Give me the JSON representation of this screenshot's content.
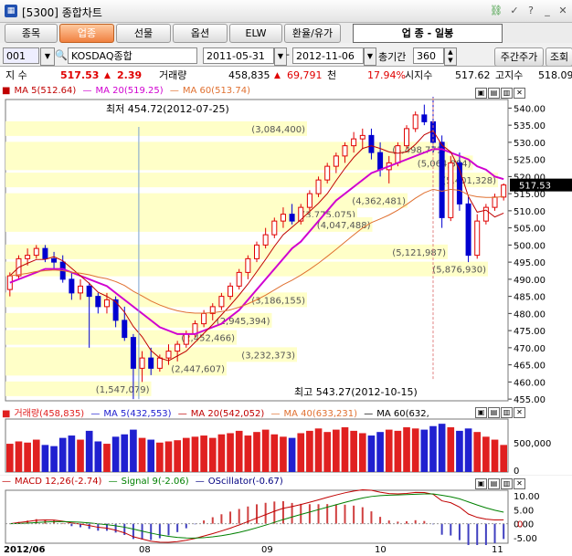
{
  "window": {
    "title": "[5300] 종합차트"
  },
  "nav": {
    "buttons": [
      "종목",
      "업종",
      "선물",
      "옵션",
      "ELW",
      "환율/유가"
    ],
    "selected": 1,
    "header_label": "업  종 - 일봉"
  },
  "datebar": {
    "code": "001",
    "index_name": "KOSDAQ종합",
    "start_date": "2011-05-31",
    "end_date": "2012-11-06",
    "period_label": "총기간",
    "period_value": "360",
    "weekly_btn": "주간주가",
    "query_btn": "조회"
  },
  "quote": {
    "label_index": "지 수",
    "index_value": "517.53",
    "change": "2.39",
    "label_volume": "거래량",
    "volume": "458,835",
    "volume_change": "69,791",
    "unit": "천",
    "volume_ratio": "17.94%",
    "label_open": "시지수",
    "open_value": "517.62",
    "label_high": "고지수",
    "high_value": "518.09"
  },
  "colors": {
    "up": "#e00000",
    "down": "#0000d0",
    "ma5": "#c00000",
    "ma20": "#d000d0",
    "ma60": "#b04010",
    "volbar": "#e02020",
    "volblue": "#2020d0",
    "box": "#ffffc8"
  },
  "price_panel": {
    "legend": [
      {
        "label": "MA 5(512.64)",
        "color": "#c00000"
      },
      {
        "label": "MA 20(519.25)",
        "color": "#d000d0"
      },
      {
        "label": "MA 60(513.74)",
        "color": "#e07030"
      }
    ],
    "low_annotation": "최저 454.72(2012-07-25)",
    "high_annotation": "최고 543.27(2012-10-15)",
    "last_price_tag": "517.53",
    "axis_ticks": [
      "540.00",
      "535.00",
      "530.00",
      "525.00",
      "520.00",
      "515.00",
      "510.00",
      "505.00",
      "500.00",
      "495.00",
      "490.00",
      "485.00",
      "480.00",
      "475.00",
      "470.00",
      "465.00",
      "460.00",
      "455.00"
    ],
    "volume_profile_labels": [
      "(3,084,400)",
      "(4,498,771)",
      "(5,064,884)",
      "(5,401,328)",
      "(4,362,481)",
      "(3,775,075)",
      "(4,047,488)",
      "(5,121,987)",
      "(5,876,930)",
      "(3,186,155)",
      "(2,945,394)",
      "(2,452,466)",
      "(3,232,373)",
      "(2,447,607)",
      "(1,547,079)"
    ]
  },
  "volume_panel": {
    "legend": [
      {
        "label": "거래량(458,835)",
        "color": "#e02020"
      },
      {
        "label": "MA 5(432,553)",
        "color": "#2020d0"
      },
      {
        "label": "MA 20(542,052)",
        "color": "#c00000"
      },
      {
        "label": "MA 40(633,231)",
        "color": "#e07030"
      },
      {
        "label": "MA 60(632,",
        "color": "#000000"
      }
    ],
    "axis_ticks": [
      "500,000",
      "0"
    ]
  },
  "macd_panel": {
    "legend": [
      {
        "label": "MACD 12,26(-2.74)",
        "color": "#c00000"
      },
      {
        "label": "Signal 9(-2.06)",
        "color": "#008000"
      },
      {
        "label": "OScillator(-0.67)",
        "color": "#000080"
      }
    ],
    "axis_ticks": [
      "10.00",
      "5.00",
      "0.00",
      "-5.00"
    ],
    "zero_label": "0"
  },
  "time_axis": {
    "labels": [
      "2012/06",
      "08",
      "09",
      "10",
      "11"
    ]
  },
  "chart_data": {
    "type": "candlestick",
    "title": "KOSDAQ종합",
    "ylim": [
      455,
      543.27
    ],
    "candles": [
      {
        "o": 487,
        "h": 492,
        "l": 485,
        "c": 491
      },
      {
        "o": 491,
        "h": 497,
        "l": 490,
        "c": 496
      },
      {
        "o": 496,
        "h": 499,
        "l": 494,
        "c": 497
      },
      {
        "o": 497,
        "h": 500,
        "l": 496,
        "c": 499
      },
      {
        "o": 499,
        "h": 500,
        "l": 495,
        "c": 496
      },
      {
        "o": 496,
        "h": 498,
        "l": 493,
        "c": 495
      },
      {
        "o": 495,
        "h": 497,
        "l": 489,
        "c": 490
      },
      {
        "o": 490,
        "h": 492,
        "l": 484,
        "c": 486
      },
      {
        "o": 486,
        "h": 490,
        "l": 484,
        "c": 488
      },
      {
        "o": 488,
        "h": 489,
        "l": 470,
        "c": 485
      },
      {
        "o": 485,
        "h": 486,
        "l": 480,
        "c": 482
      },
      {
        "o": 482,
        "h": 486,
        "l": 480,
        "c": 484
      },
      {
        "o": 484,
        "h": 485,
        "l": 476,
        "c": 478
      },
      {
        "o": 478,
        "h": 482,
        "l": 472,
        "c": 473
      },
      {
        "o": 473,
        "h": 474,
        "l": 455,
        "c": 464
      },
      {
        "o": 464,
        "h": 469,
        "l": 460,
        "c": 467
      },
      {
        "o": 467,
        "h": 470,
        "l": 462,
        "c": 464
      },
      {
        "o": 464,
        "h": 468,
        "l": 463,
        "c": 467
      },
      {
        "o": 467,
        "h": 471,
        "l": 465,
        "c": 469
      },
      {
        "o": 469,
        "h": 472,
        "l": 466,
        "c": 471
      },
      {
        "o": 471,
        "h": 475,
        "l": 470,
        "c": 474
      },
      {
        "o": 474,
        "h": 478,
        "l": 473,
        "c": 477
      },
      {
        "o": 477,
        "h": 481,
        "l": 476,
        "c": 480
      },
      {
        "o": 480,
        "h": 483,
        "l": 478,
        "c": 482
      },
      {
        "o": 482,
        "h": 486,
        "l": 481,
        "c": 485
      },
      {
        "o": 485,
        "h": 489,
        "l": 484,
        "c": 488
      },
      {
        "o": 488,
        "h": 493,
        "l": 487,
        "c": 492
      },
      {
        "o": 492,
        "h": 497,
        "l": 490,
        "c": 496
      },
      {
        "o": 496,
        "h": 501,
        "l": 495,
        "c": 500
      },
      {
        "o": 500,
        "h": 505,
        "l": 499,
        "c": 503
      },
      {
        "o": 503,
        "h": 508,
        "l": 502,
        "c": 507
      },
      {
        "o": 507,
        "h": 511,
        "l": 505,
        "c": 509
      },
      {
        "o": 509,
        "h": 512,
        "l": 506,
        "c": 507
      },
      {
        "o": 507,
        "h": 512,
        "l": 506,
        "c": 511
      },
      {
        "o": 511,
        "h": 516,
        "l": 510,
        "c": 515
      },
      {
        "o": 515,
        "h": 520,
        "l": 514,
        "c": 519
      },
      {
        "o": 519,
        "h": 524,
        "l": 518,
        "c": 523
      },
      {
        "o": 523,
        "h": 527,
        "l": 521,
        "c": 526
      },
      {
        "o": 526,
        "h": 530,
        "l": 524,
        "c": 529
      },
      {
        "o": 529,
        "h": 533,
        "l": 527,
        "c": 531
      },
      {
        "o": 531,
        "h": 534,
        "l": 528,
        "c": 532
      },
      {
        "o": 532,
        "h": 534,
        "l": 525,
        "c": 527
      },
      {
        "o": 527,
        "h": 530,
        "l": 520,
        "c": 522
      },
      {
        "o": 522,
        "h": 526,
        "l": 518,
        "c": 524
      },
      {
        "o": 524,
        "h": 530,
        "l": 523,
        "c": 529
      },
      {
        "o": 529,
        "h": 535,
        "l": 528,
        "c": 534
      },
      {
        "o": 534,
        "h": 539,
        "l": 533,
        "c": 538
      },
      {
        "o": 538,
        "h": 541,
        "l": 535,
        "c": 536
      },
      {
        "o": 536,
        "h": 543.27,
        "l": 527,
        "c": 530
      },
      {
        "o": 530,
        "h": 532,
        "l": 505,
        "c": 508
      },
      {
        "o": 508,
        "h": 526,
        "l": 507,
        "c": 524
      },
      {
        "o": 524,
        "h": 527,
        "l": 510,
        "c": 512
      },
      {
        "o": 512,
        "h": 514,
        "l": 495,
        "c": 497
      },
      {
        "o": 497,
        "h": 509,
        "l": 496,
        "c": 507
      },
      {
        "o": 507,
        "h": 512,
        "l": 506,
        "c": 511
      },
      {
        "o": 511,
        "h": 515,
        "l": 510,
        "c": 514
      },
      {
        "o": 514,
        "h": 518,
        "l": 513,
        "c": 517.53
      }
    ],
    "ma20": [
      489,
      490,
      491,
      492,
      493,
      493,
      493,
      492,
      491,
      490,
      489,
      488,
      486,
      484,
      482,
      480,
      478,
      476,
      475,
      474,
      474,
      474,
      475,
      476,
      477,
      479,
      481,
      484,
      487,
      490,
      493,
      496,
      499,
      501,
      504,
      507,
      510,
      513,
      515,
      517,
      519,
      521,
      522,
      523,
      524,
      525,
      526,
      527,
      528,
      528,
      527,
      526,
      525,
      523,
      522,
      520,
      519.25
    ],
    "volume": [
      48,
      52,
      50,
      55,
      46,
      44,
      58,
      62,
      55,
      70,
      52,
      48,
      60,
      64,
      72,
      58,
      55,
      50,
      52,
      54,
      58,
      60,
      62,
      58,
      64,
      66,
      70,
      62,
      68,
      72,
      64,
      60,
      58,
      66,
      70,
      74,
      68,
      72,
      76,
      70,
      66,
      62,
      68,
      72,
      70,
      76,
      74,
      72,
      78,
      82,
      76,
      70,
      74,
      68,
      60,
      55,
      46
    ]
  }
}
